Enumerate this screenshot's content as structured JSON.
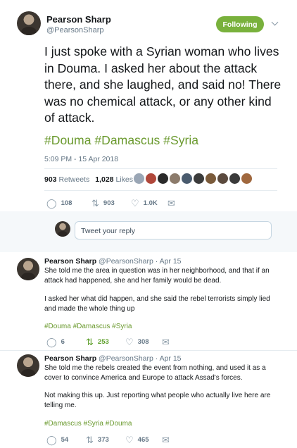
{
  "main_tweet": {
    "author_name": "Pearson Sharp",
    "author_handle": "@PearsonSharp",
    "follow_label": "Following",
    "text": "I just spoke with a Syrian woman who lives in Douma. I asked her about the attack there, and she laughed, and said no! There was no chemical attack, or any other kind of attack.",
    "hashtags": "#Douma #Damascus #Syria",
    "timestamp": "5:09 PM - 15 Apr 2018",
    "retweets_count": "903",
    "retweets_label": "Retweets",
    "likes_count": "1,028",
    "likes_label": "Likes",
    "liker_avatar_colors": [
      "#9aa6b5",
      "#b0473a",
      "#2a2a2a",
      "#8c7b6b",
      "#4a5b6e",
      "#3b3b3b",
      "#7a5a3a",
      "#5b4a3e",
      "#3a3a3a",
      "#a0683e"
    ],
    "actions": {
      "replies": "108",
      "retweets": "903",
      "likes": "1.0K"
    }
  },
  "reply_box": {
    "placeholder": "Tweet your reply"
  },
  "replies": [
    {
      "author_name": "Pearson Sharp",
      "meta": "@PearsonSharp · Apr 15",
      "paragraph1": "She told me the area in question was in her neighborhood, and that if an attack had happened, she and her family would be dead.",
      "paragraph2": "I asked her what did happen, and she said the rebel terrorists simply lied and made the whole thing up",
      "hashtags": "#Douma #Damascus #Syria",
      "actions": {
        "replies": "6",
        "retweets": "253",
        "likes": "308"
      }
    },
    {
      "author_name": "Pearson Sharp",
      "meta": "@PearsonSharp · Apr 15",
      "paragraph1": "She told me the rebels created the event from nothing, and used it as a cover to convince America and Europe to attack Assad's forces.",
      "paragraph2": "Not making this up. Just reporting what people who actually live here are telling me.",
      "hashtags": "#Damascus #Syria #Douma",
      "actions": {
        "replies": "54",
        "retweets": "373",
        "likes": "465"
      }
    }
  ]
}
